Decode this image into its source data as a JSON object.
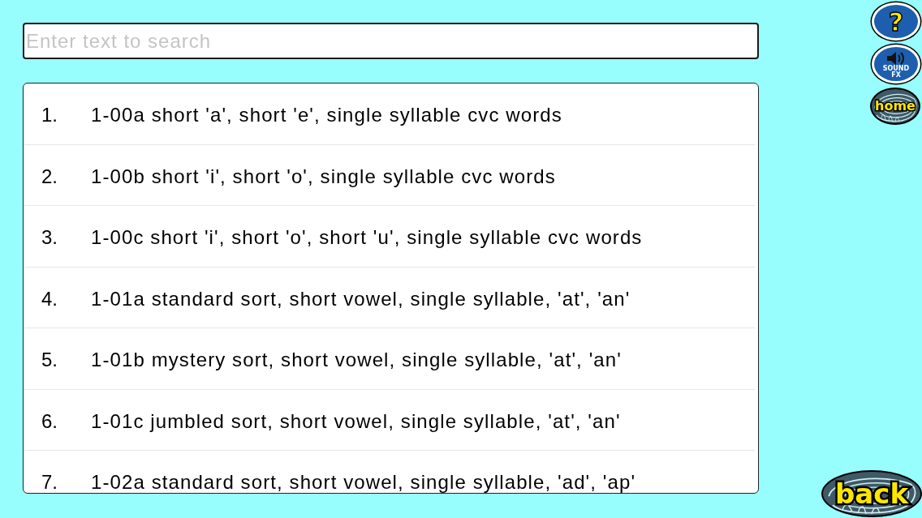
{
  "search": {
    "placeholder": "Enter text to search"
  },
  "list": {
    "items": [
      {
        "number": "1.",
        "title": "1-00a short 'a', short 'e', single syllable cvc words"
      },
      {
        "number": "2.",
        "title": "1-00b short 'i', short 'o', single syllable cvc words"
      },
      {
        "number": "3.",
        "title": "1-00c short 'i', short 'o', short 'u', single syllable cvc words"
      },
      {
        "number": "4.",
        "title": "1-01a standard sort, short vowel, single syllable, 'at', 'an'"
      },
      {
        "number": "5.",
        "title": "1-01b mystery sort, short vowel, single syllable, 'at', 'an'"
      },
      {
        "number": "6.",
        "title": "1-01c jumbled sort, short vowel, single syllable, 'at', 'an'"
      },
      {
        "number": "7.",
        "title": "1-02a standard sort, short vowel, single syllable, 'ad', 'ap'"
      }
    ]
  },
  "side_buttons": [
    {
      "kind": "help",
      "label": "?"
    },
    {
      "kind": "sound",
      "label": "SOUND FX"
    },
    {
      "kind": "home",
      "label": "home"
    }
  ],
  "back_button": {
    "label": "back"
  }
}
